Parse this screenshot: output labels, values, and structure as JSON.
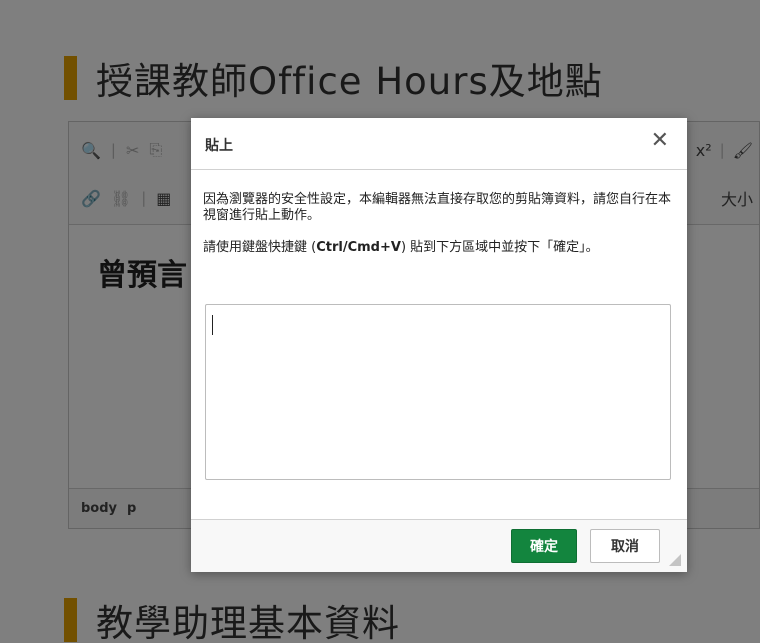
{
  "page": {
    "section1_title": "授課教師Office Hours及地點",
    "section2_title": "教學助理基本資料"
  },
  "editor": {
    "toolbar_row1_left": [
      "🔍",
      "✂",
      "⎘"
    ],
    "toolbar_row1_right": [
      "x²",
      "🖌"
    ],
    "toolbar_row2_left": [
      "🔗",
      "⛓",
      "▦"
    ],
    "toolbar_row2_right": "大小",
    "content_text": "曾預言",
    "path": [
      "body",
      "p"
    ]
  },
  "dialog": {
    "title": "貼上",
    "close_icon": "✕",
    "message1": "因為瀏覽器的安全性設定，本編輯器無法直接存取您的剪貼簿資料，請您自行在本視窗進行貼上動作。",
    "message2_prefix": "請使用鍵盤快捷鍵 (",
    "message2_shortcut": "Ctrl/Cmd+V",
    "message2_suffix": ") 貼到下方區域中並按下「確定」。",
    "paste_area_value": "",
    "ok_label": "確定",
    "cancel_label": "取消"
  },
  "colors": {
    "accent_bar": "#e5a100",
    "ok_button": "#13853e"
  }
}
